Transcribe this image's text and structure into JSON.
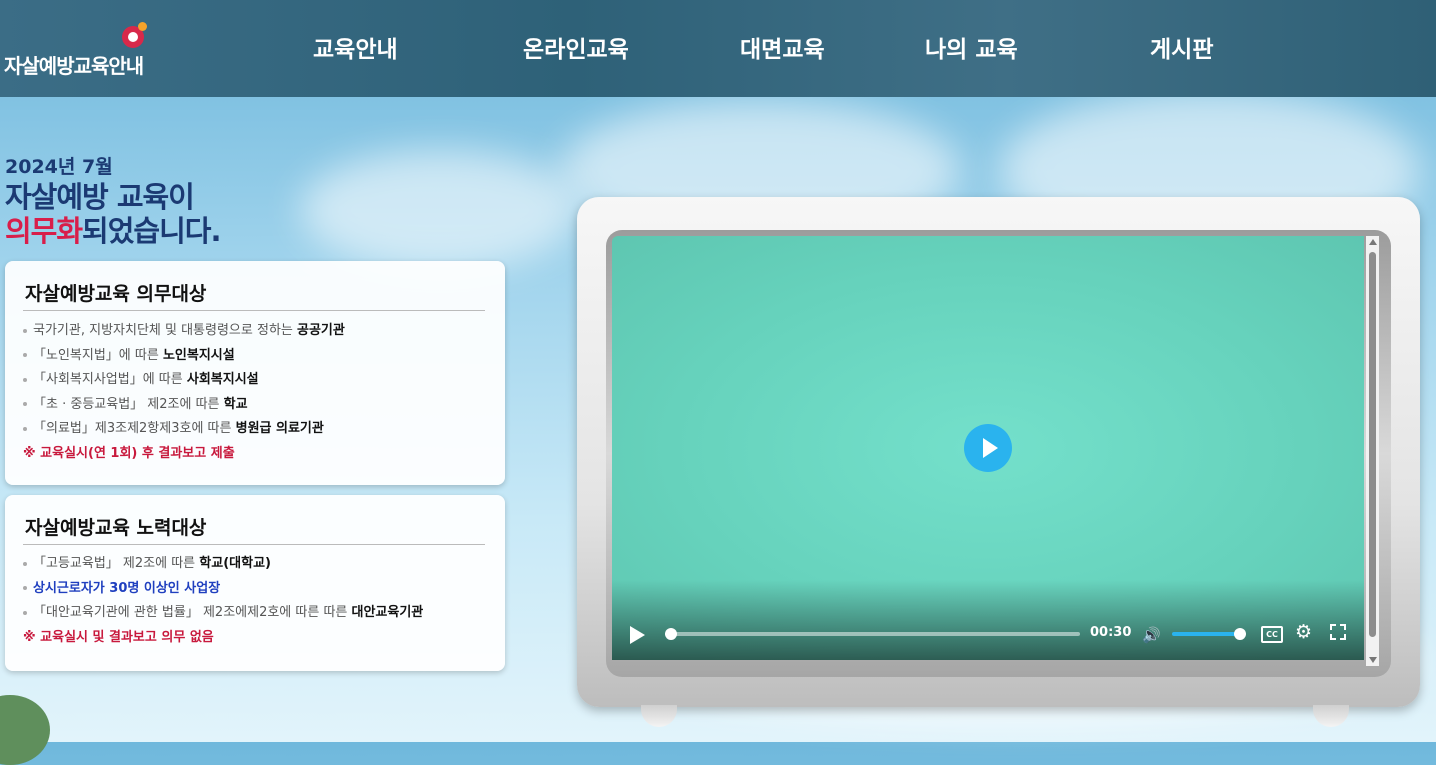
{
  "brand": {
    "name": "자살예방교육안내",
    "accent": "#d8294a"
  },
  "nav": [
    {
      "label": "교육안내"
    },
    {
      "label": "온라인교육"
    },
    {
      "label": "대면교육"
    },
    {
      "label": "나의 교육"
    },
    {
      "label": "게시판"
    }
  ],
  "hero": {
    "date": "2024년 7월",
    "line1": "자살예방 교육이",
    "line2_red": "의무화",
    "line2_rest": "되었습니다."
  },
  "card1": {
    "title": "자살예방교육 의무대상",
    "items": [
      {
        "text": "국가기관, 지방자치단체 및 대통령령으로 정하는 ",
        "bold": "공공기관"
      },
      {
        "text": "「노인복지법」에 따른 ",
        "bold": "노인복지시설"
      },
      {
        "text": "「사회복지사업법」에 따른 ",
        "bold": "사회복지시설"
      },
      {
        "text": "「초 · 중등교육법」 제2조에 따른 ",
        "bold": "학교"
      },
      {
        "text": "「의료법」제3조제2항제3호에 따른 ",
        "bold": "병원급 의료기관"
      }
    ],
    "note": "※ 교육실시(연 1회) 후 결과보고 제출"
  },
  "card2": {
    "title": "자살예방교육 노력대상",
    "items": [
      {
        "text": "「고등교육법」 제2조에 따른 ",
        "bold": "학교(대학교)"
      },
      {
        "text": "상시근로자가 30명 이상인 사업장",
        "bold": ""
      },
      {
        "text": "「대안교육기관에 관한 법률」 제2조에제2호에 따른 따른 ",
        "bold": "대안교육기관"
      }
    ],
    "note": "※ 교육실시 및 결과보고 의무 없음"
  },
  "video": {
    "time": "00:30",
    "cc_label": "CC",
    "progress": 0,
    "volume": 1.0,
    "screen_color": "#6ad8c2",
    "accent": "#2ab3ee"
  }
}
